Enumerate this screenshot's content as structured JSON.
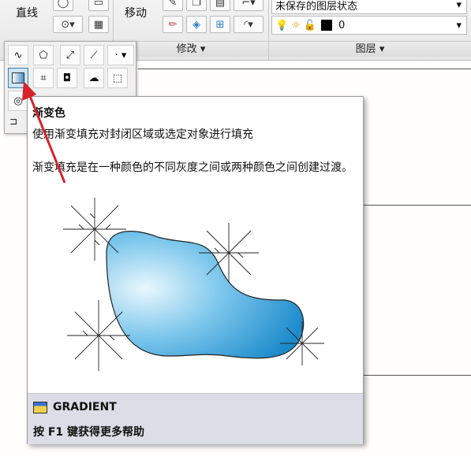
{
  "ribbon": {
    "line_label": "直线",
    "move_label": "移动",
    "modify_panel_label": "修改",
    "layer_panel_label": "图层",
    "layer_state_text": "未保存的图层状态",
    "current_layer_value": "0"
  },
  "tooltip": {
    "title": "渐变色",
    "summary": "使用渐变填充对封闭区域或选定对象进行填充",
    "description": "渐变填充是在一种颜色的不同灰度之间或两种颜色之间创建过渡。",
    "command": "GRADIENT",
    "help": "按 F1 键获得更多帮助"
  },
  "colors": {
    "gradient_fill_light": "#e8f6fd",
    "gradient_fill_dark": "#1f8fd0",
    "arrow": "#d8232a",
    "tooltip_footer": "#dcdde6"
  }
}
